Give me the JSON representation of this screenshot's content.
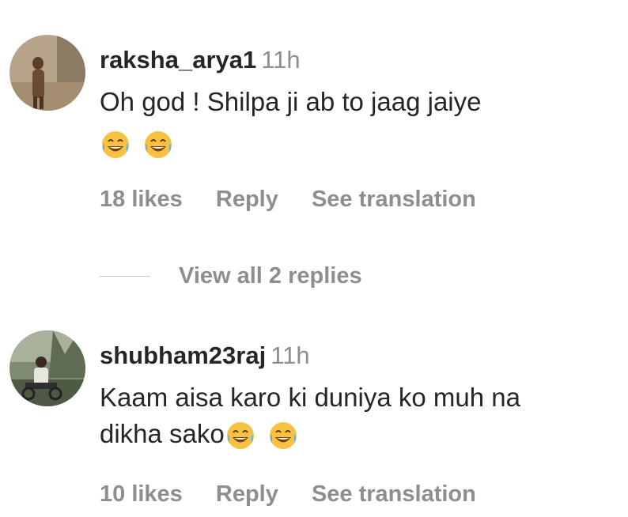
{
  "comments": [
    {
      "username": "raksha_arya1",
      "time": "11h",
      "text_line1": "Oh god ! Shilpa ji ab to jaag jaiye",
      "text_line2": "",
      "likes": "18 likes",
      "reply": "Reply",
      "translate": "See translation"
    },
    {
      "username": "shubham23raj",
      "time": "11h",
      "text_line1": "Kaam aisa karo ki duniya ko muh na",
      "text_line2": "dikha sako",
      "likes": "10 likes",
      "reply": "Reply",
      "translate": "See translation"
    }
  ],
  "view_replies": "View all 2 replies",
  "emoji_icon": "face-with-tears-of-joy-icon",
  "colors": {
    "text": "#262626",
    "muted": "#8e8e8e",
    "emoji_face": "#f7c242"
  }
}
